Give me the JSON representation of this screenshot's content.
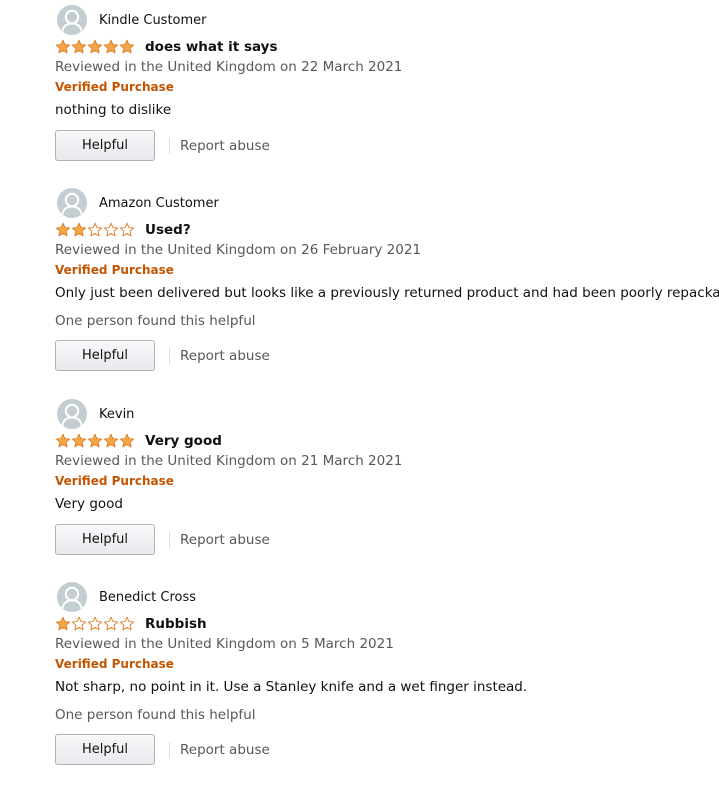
{
  "colors": {
    "star_fill": "#f3a847",
    "star_stroke": "#de7921",
    "verified": "#c45500",
    "meta_text": "#565959"
  },
  "reviews": [
    {
      "reviewer": "Kindle Customer",
      "avatar_icon": "person-silhouette-icon",
      "rating": 5,
      "title": "does what it says",
      "date": "Reviewed in the United Kingdom on 22 March 2021",
      "verified": "Verified Purchase",
      "body": "nothing to dislike",
      "helpful_count": "",
      "helpful_label": "Helpful",
      "report_label": "Report abuse"
    },
    {
      "reviewer": "Amazon Customer",
      "avatar_icon": "person-silhouette-icon",
      "rating": 2,
      "title": "Used?",
      "date": "Reviewed in the United Kingdom on 26 February 2021",
      "verified": "Verified Purchase",
      "body": "Only just been delivered but looks like a previously returned product and had been poorly repackaged",
      "helpful_count": "One person found this helpful",
      "helpful_label": "Helpful",
      "report_label": "Report abuse"
    },
    {
      "reviewer": "Kevin",
      "avatar_icon": "person-silhouette-icon",
      "rating": 5,
      "title": "Very good",
      "date": "Reviewed in the United Kingdom on 21 March 2021",
      "verified": "Verified Purchase",
      "body": "Very good",
      "helpful_count": "",
      "helpful_label": "Helpful",
      "report_label": "Report abuse"
    },
    {
      "reviewer": "Benedict Cross",
      "avatar_icon": "person-silhouette-icon",
      "rating": 1,
      "title": "Rubbish",
      "date": "Reviewed in the United Kingdom on 5 March 2021",
      "verified": "Verified Purchase",
      "body": "Not sharp, no point in it. Use a Stanley knife and a wet finger instead.",
      "helpful_count": "One person found this helpful",
      "helpful_label": "Helpful",
      "report_label": "Report abuse"
    }
  ]
}
